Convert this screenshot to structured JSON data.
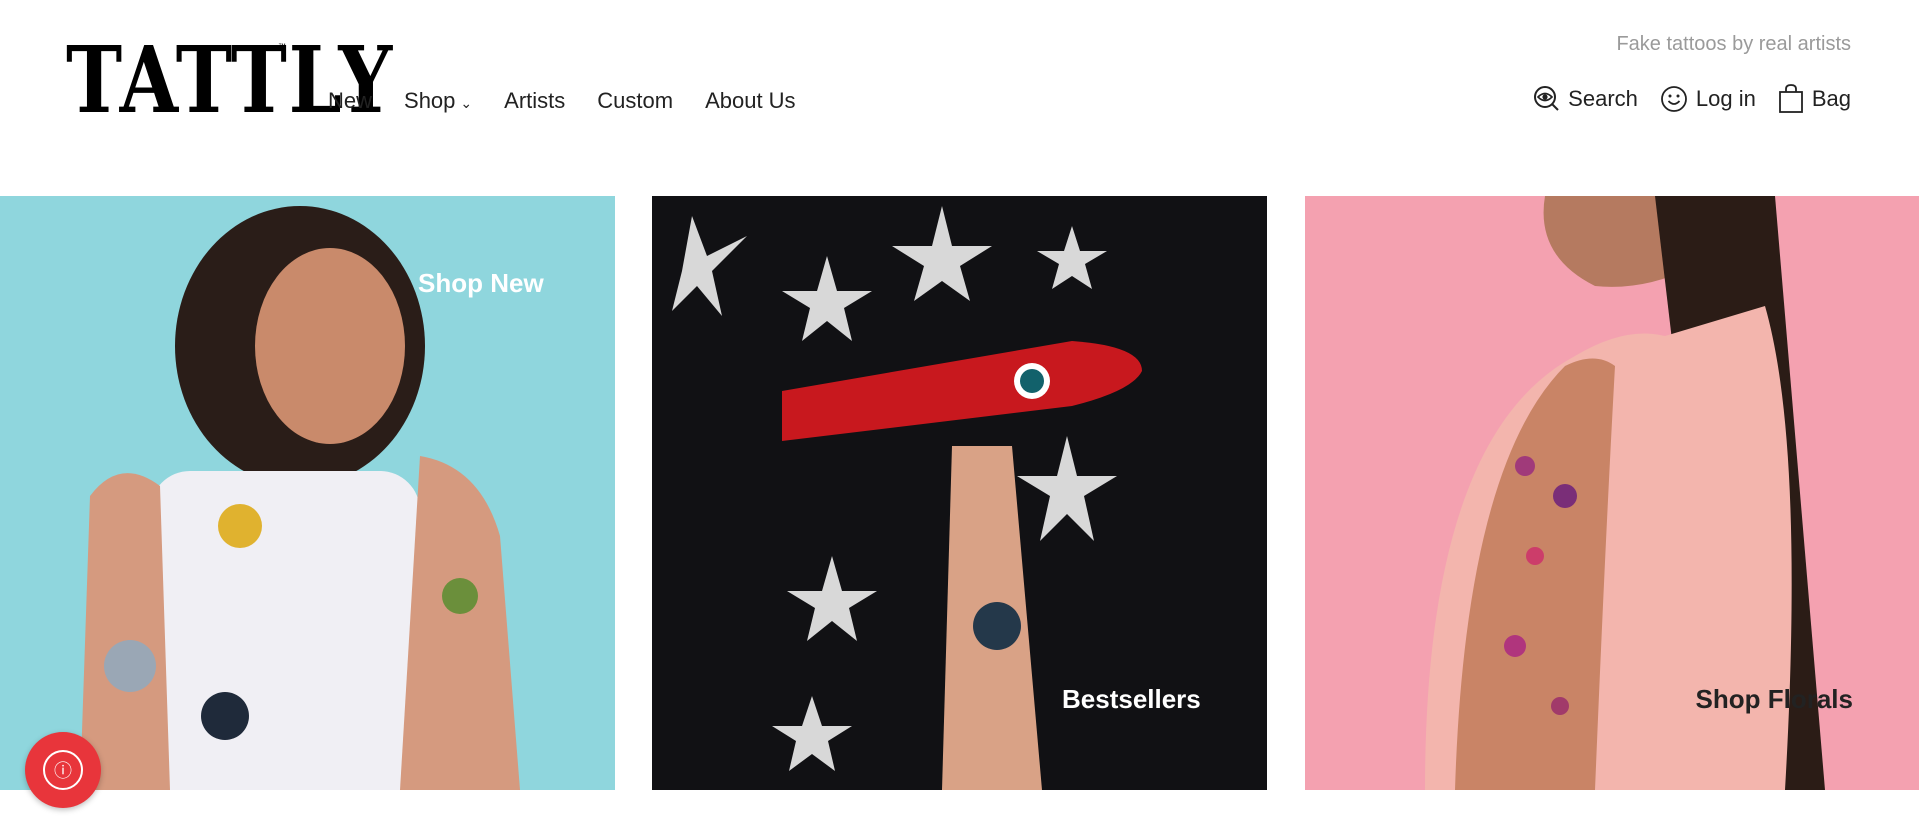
{
  "brand": {
    "name": "TATTLY",
    "tm": "™"
  },
  "nav": {
    "items": [
      {
        "label": "New"
      },
      {
        "label": "Shop"
      },
      {
        "label": "Artists"
      },
      {
        "label": "Custom"
      },
      {
        "label": "About Us"
      }
    ]
  },
  "header": {
    "tagline": "Fake tattoos by real artists",
    "search_label": "Search",
    "login_label": "Log in",
    "bag_label": "Bag"
  },
  "panels": [
    {
      "label": "Shop New",
      "background": "#8fd6dd"
    },
    {
      "label": "Bestsellers",
      "background": "#111114"
    },
    {
      "label": "Shop Florals",
      "background": "#f4a1b0"
    }
  ],
  "colors": {
    "rewards_button": "#e8353b",
    "tagline": "#9a9a9a"
  },
  "icons": [
    "eye-search-icon",
    "smiley-icon",
    "bag-icon",
    "chevron-down-icon",
    "rewards-icon"
  ]
}
